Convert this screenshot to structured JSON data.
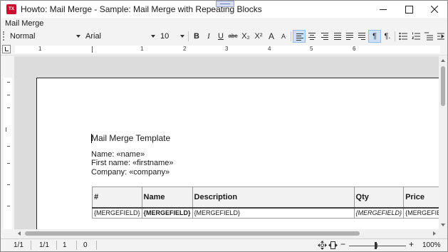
{
  "window": {
    "title": "Howto: Mail Merge - Sample: Mail Merge with Repeating Blocks",
    "app_icon_text": "TX"
  },
  "menu": {
    "items": [
      "Mail Merge"
    ]
  },
  "toolbar": {
    "style": "Normal",
    "font": "Arial",
    "size": "10",
    "buttons": {
      "bold": "B",
      "italic": "I",
      "underline": "U",
      "strikethrough": "abc",
      "subscript": "X₂",
      "superscript": "X²",
      "grow_font": "A",
      "shrink_font": "A",
      "pilcrow_ltr": "¶",
      "pilcrow": "¶."
    }
  },
  "ruler": {
    "numbers": [
      "1",
      "1",
      "2",
      "3",
      "4",
      "5",
      "6"
    ]
  },
  "document": {
    "heading": "Mail Merge Template",
    "name_line": "Name: «name»",
    "firstname_line": "First name: «firstname»",
    "company_line": "Company: «company»",
    "table": {
      "headers": [
        "#",
        "Name",
        "Description",
        "Qty",
        "Price"
      ],
      "row": [
        "{MERGEFIELD}",
        "{MERGEFIELD}",
        "{MERGEFIELD}",
        "{MERGEFIELD}",
        "{MERGEFIEL"
      ]
    }
  },
  "status": {
    "page": "1/1",
    "section": "1/1",
    "line": "1",
    "column": "0",
    "zoom_out": "−",
    "zoom_in": "+",
    "zoom": "100%"
  },
  "colors": {
    "accent": "#cde0f7",
    "app_icon": "#c8102e"
  },
  "icons": [
    "app-icon",
    "minimize-icon",
    "maximize-icon",
    "close-icon",
    "align-left-icon",
    "align-center-icon",
    "align-right-icon",
    "justify-icon",
    "bullet-list-icon",
    "numbered-list-icon",
    "indent-icon",
    "tab-stop-icon",
    "move-icon",
    "fit-width-icon"
  ]
}
